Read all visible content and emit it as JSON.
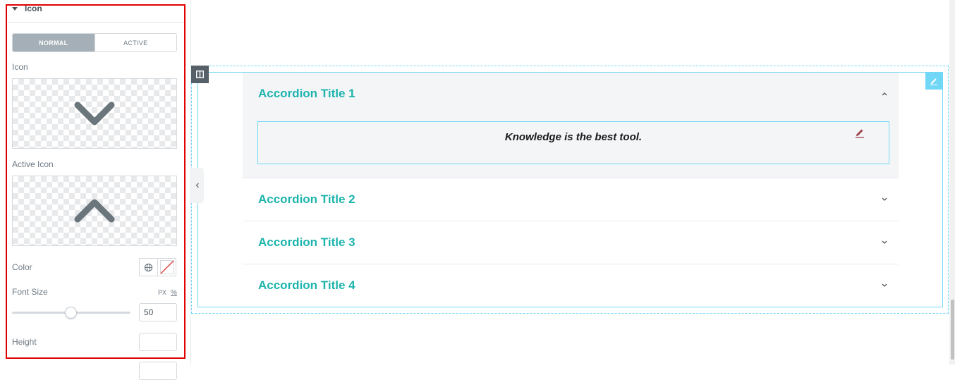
{
  "panel": {
    "section_title": "Icon",
    "tabs": [
      {
        "label": "NORMAL",
        "active": true
      },
      {
        "label": "ACTIVE",
        "active": false
      }
    ],
    "icon_label": "Icon",
    "icon_preview": "chevron-down-icon",
    "active_icon_label": "Active Icon",
    "active_icon_preview": "chevron-up-icon",
    "color_label": "Color",
    "font_size_label": "Font Size",
    "font_size_unit": "PX",
    "font_size_alt_unit": "%",
    "font_size_value": "50",
    "font_size_slider_fraction": 0.5,
    "height_label": "Height",
    "height_value": ""
  },
  "accordion": {
    "items": [
      {
        "title": "Accordion Title 1",
        "open": true,
        "content": "Knowledge is the best tool."
      },
      {
        "title": "Accordion Title 2",
        "open": false
      },
      {
        "title": "Accordion Title 3",
        "open": false
      },
      {
        "title": "Accordion Title 4",
        "open": false
      }
    ]
  },
  "colors": {
    "title_color": "#1cb4ac",
    "accent_outline": "#71d7f7",
    "active_tab": "#a4afb7",
    "highlight_box": "#e00000"
  }
}
